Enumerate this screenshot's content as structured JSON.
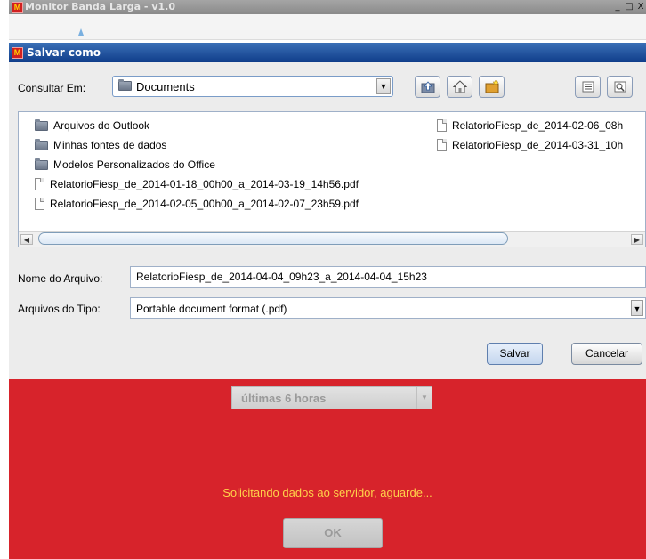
{
  "main_window": {
    "title": "Monitor Banda Larga - v1.0",
    "controls": [
      "_",
      "□",
      "X"
    ]
  },
  "dialog": {
    "title": "Salvar como",
    "look_in_label": "Consultar Em:",
    "look_in_value": "Documents",
    "toolbar_icons": [
      "up-one-level-icon",
      "home-icon",
      "new-folder-icon",
      "list-view-icon",
      "details-view-icon"
    ],
    "files_col1": [
      {
        "name": "Arquivos do Outlook",
        "type": "folder"
      },
      {
        "name": "Minhas fontes de dados",
        "type": "folder"
      },
      {
        "name": "Modelos Personalizados do Office",
        "type": "folder"
      },
      {
        "name": "RelatorioFiesp_de_2014-01-18_00h00_a_2014-03-19_14h56.pdf",
        "type": "file"
      },
      {
        "name": "RelatorioFiesp_de_2014-02-05_00h00_a_2014-02-07_23h59.pdf",
        "type": "file"
      }
    ],
    "files_col2": [
      {
        "name": "RelatorioFiesp_de_2014-02-06_08h",
        "type": "file"
      },
      {
        "name": "RelatorioFiesp_de_2014-03-31_10h",
        "type": "file"
      }
    ],
    "file_name_label": "Nome do Arquivo:",
    "file_name_value": "RelatorioFiesp_de_2014-04-04_09h23_a_2014-04-04_15h23",
    "file_type_label": "Arquivos do Tipo:",
    "file_type_value": "Portable document format (.pdf)",
    "save_label": "Salvar",
    "cancel_label": "Cancelar"
  },
  "app_panel": {
    "period_value": "últimas 6 horas",
    "status_text": "Solicitando dados ao servidor, aguarde...",
    "ok_label": "OK",
    "background": "#d7232b",
    "status_color": "#ffd24a"
  }
}
